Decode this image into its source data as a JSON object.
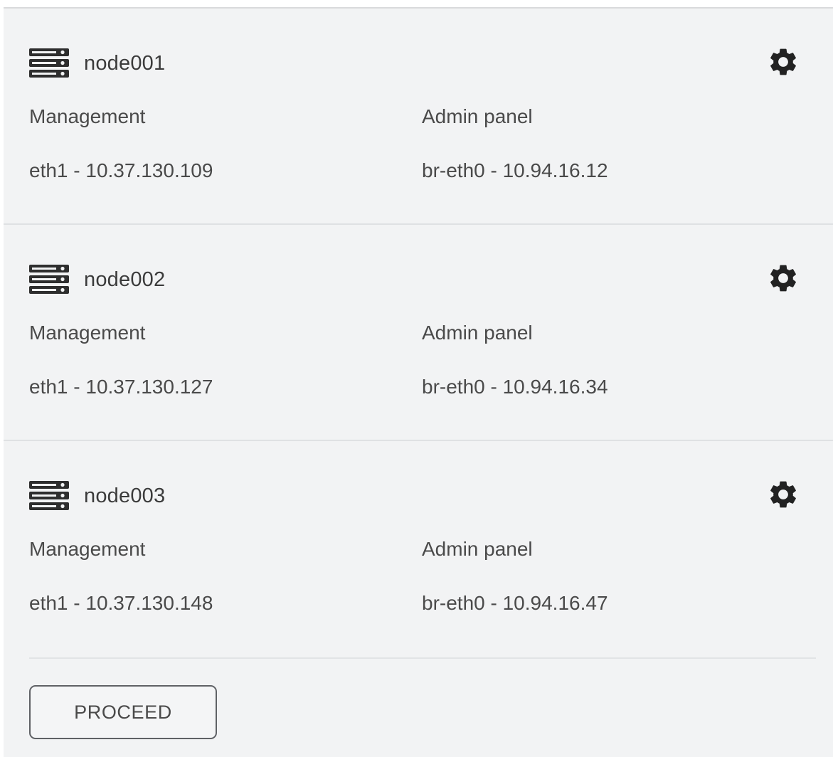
{
  "nodes": [
    {
      "name": "node001",
      "management_label": "Management",
      "management_value": "eth1 - 10.37.130.109",
      "admin_label": "Admin panel",
      "admin_value": "br-eth0 - 10.94.16.12"
    },
    {
      "name": "node002",
      "management_label": "Management",
      "management_value": "eth1 - 10.37.130.127",
      "admin_label": "Admin panel",
      "admin_value": "br-eth0 - 10.94.16.34"
    },
    {
      "name": "node003",
      "management_label": "Management",
      "management_value": "eth1 - 10.37.130.148",
      "admin_label": "Admin panel",
      "admin_value": "br-eth0 - 10.94.16.47"
    }
  ],
  "actions": {
    "proceed_label": "PROCEED"
  },
  "icons": {
    "node": "server-icon",
    "settings": "gear-icon"
  },
  "colors": {
    "panel_background": "#f2f3f4",
    "text": "#4a4a4a",
    "icon": "#2b2b2b"
  }
}
